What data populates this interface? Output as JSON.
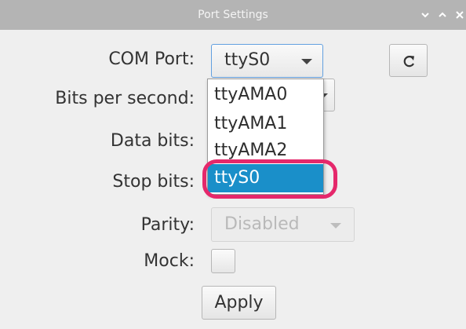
{
  "window": {
    "title": "Port Settings",
    "controls": [
      "chevron-down-icon",
      "chevron-up-icon",
      "close-icon"
    ]
  },
  "form": {
    "com_port": {
      "label": "COM Port:",
      "value": "ttyS0"
    },
    "bits_per_second": {
      "label": "Bits per second:"
    },
    "data_bits": {
      "label": "Data bits:"
    },
    "stop_bits": {
      "label": "Stop bits:"
    },
    "parity": {
      "label": "Parity:",
      "value": "Disabled",
      "enabled": false
    },
    "mock": {
      "label": "Mock:",
      "checked": false
    },
    "apply_label": "Apply",
    "refresh_icon": "refresh-icon"
  },
  "dropdown": {
    "items": [
      "ttyAMA0",
      "ttyAMA1",
      "ttyAMA2",
      "ttyS0"
    ],
    "selected": "ttyS0"
  },
  "colors": {
    "selection": "#1a8fc9",
    "annotation_ring": "#e5286b",
    "titlebar": "#b4b4b4"
  }
}
